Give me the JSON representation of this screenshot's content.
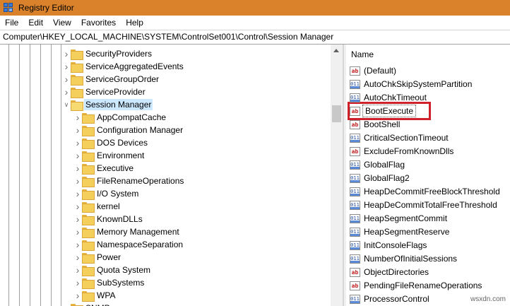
{
  "window": {
    "title": "Registry Editor",
    "icon": "registry-icon"
  },
  "menu": [
    "File",
    "Edit",
    "View",
    "Favorites",
    "Help"
  ],
  "address": "Computer\\HKEY_LOCAL_MACHINE\\SYSTEM\\ControlSet001\\Control\\Session Manager",
  "tree": {
    "siblings": [
      "SecurityProviders",
      "ServiceAggregatedEvents",
      "ServiceGroupOrder",
      "ServiceProvider"
    ],
    "selected": "Session Manager",
    "children": [
      "AppCompatCache",
      "Configuration Manager",
      "DOS Devices",
      "Environment",
      "Executive",
      "FileRenameOperations",
      "I/O System",
      "kernel",
      "KnownDLLs",
      "Memory Management",
      "NamespaceSeparation",
      "Power",
      "Quota System",
      "SubSystems",
      "WPA"
    ],
    "next_sibling": "SNMP"
  },
  "values": {
    "column_header": "Name",
    "items": [
      {
        "name": "(Default)",
        "type": "string"
      },
      {
        "name": "AutoChkSkipSystemPartition",
        "type": "binary"
      },
      {
        "name": "AutoChkTimeout",
        "type": "binary"
      },
      {
        "name": "BootExecute",
        "type": "string",
        "highlighted": true
      },
      {
        "name": "BootShell",
        "type": "string"
      },
      {
        "name": "CriticalSectionTimeout",
        "type": "binary"
      },
      {
        "name": "ExcludeFromKnownDlls",
        "type": "string"
      },
      {
        "name": "GlobalFlag",
        "type": "binary"
      },
      {
        "name": "GlobalFlag2",
        "type": "binary"
      },
      {
        "name": "HeapDeCommitFreeBlockThreshold",
        "type": "binary"
      },
      {
        "name": "HeapDeCommitTotalFreeThreshold",
        "type": "binary"
      },
      {
        "name": "HeapSegmentCommit",
        "type": "binary"
      },
      {
        "name": "HeapSegmentReserve",
        "type": "binary"
      },
      {
        "name": "InitConsoleFlags",
        "type": "binary"
      },
      {
        "name": "NumberOfInitialSessions",
        "type": "binary"
      },
      {
        "name": "ObjectDirectories",
        "type": "string"
      },
      {
        "name": "PendingFileRenameOperations",
        "type": "string"
      },
      {
        "name": "ProcessorControl",
        "type": "binary"
      }
    ]
  },
  "icon_glyphs": {
    "string": "ab",
    "binary": "011"
  },
  "colors": {
    "titlebar": "#d9822b",
    "selection": "#cce8ff",
    "highlight": "#d0202a"
  },
  "watermark": "wsxdn.com"
}
